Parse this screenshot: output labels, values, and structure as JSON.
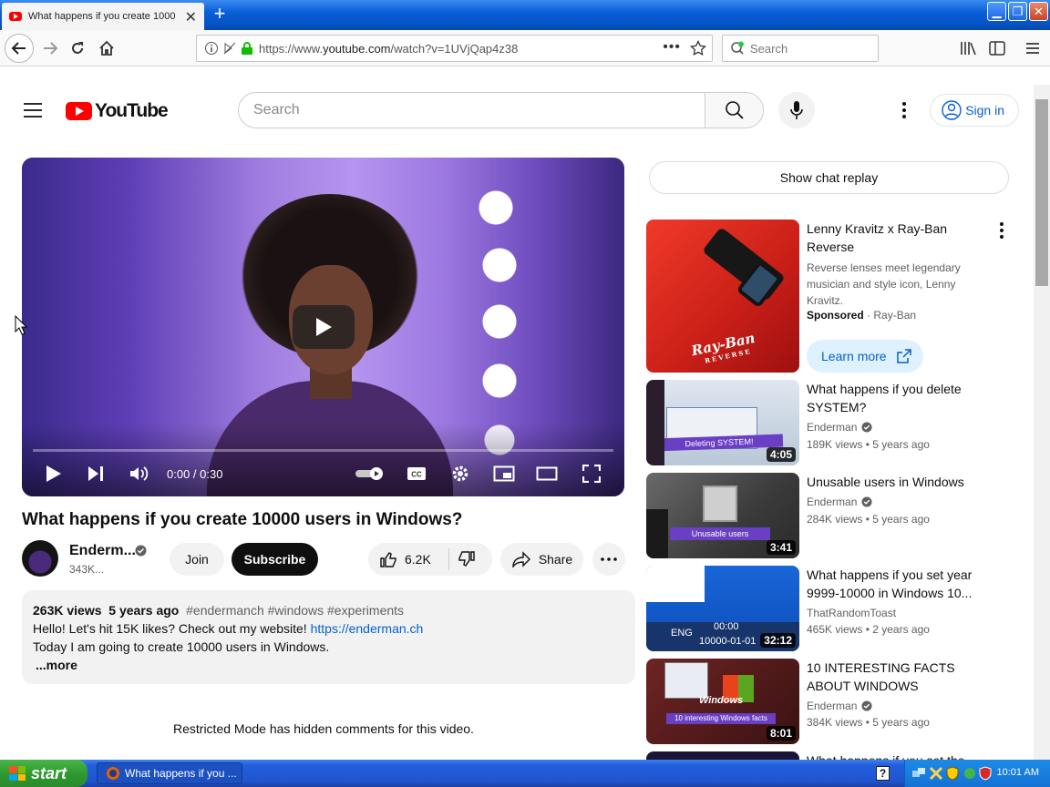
{
  "browser": {
    "tab_title": "What happens if you create 1000",
    "url": "https://www.youtube.com/watch?v=1UVjQap4z38",
    "url_prefix": "https://www.",
    "url_domain": "youtube.com",
    "url_path": "/watch?v=1UVjQap4z38",
    "search_placeholder": "Search"
  },
  "youtube": {
    "logo_text": "YouTube",
    "search_placeholder": "Search",
    "sign_in_label": "Sign in",
    "accent": "#ff0000",
    "link_color": "#065fd4"
  },
  "player": {
    "time": "0:00 / 0:30",
    "progress_fraction": 0.0
  },
  "video": {
    "title": "What happens if you create 10000 users in Windows?",
    "channel_name": "Enderm...",
    "subscribers": "343K...",
    "join_label": "Join",
    "subscribe_label": "Subscribe",
    "likes": "6.2K",
    "share_label": "Share"
  },
  "description": {
    "views": "263K views",
    "age": "5 years ago",
    "tags": "#endermanch #windows #experiments",
    "line1_text": "Hello! Let's hit 15K likes? Check out my website!",
    "line1_link": "https://enderman.ch",
    "line2": "Today I am going to create 10000 users in Windows.",
    "more_label": "...more"
  },
  "comments_note": "Restricted Mode has hidden comments for this video.",
  "sidebar": {
    "chat_replay_label": "Show chat replay",
    "ad": {
      "title": "Lenny Kravitz x Ray-Ban Reverse",
      "description": "Reverse lenses meet legendary musician and style icon, Lenny Kravitz.",
      "sponsored_label": "Sponsored",
      "sponsor_sep": "·",
      "advertiser": "Ray-Ban",
      "learn_more_label": "Learn more",
      "thumb_brand": "Ray-Ban",
      "thumb_sub": "REVERSE"
    },
    "recommendations": [
      {
        "title": "What happens if you delete SYSTEM?",
        "channel": "Enderman",
        "meta": "189K views • 5 years ago",
        "duration": "4:05",
        "thumb_caption": "Deleting SYSTEM!"
      },
      {
        "title": "Unusable users in Windows",
        "channel": "Enderman",
        "meta": "284K views • 5 years ago",
        "duration": "3:41",
        "thumb_caption": "Unusable users"
      },
      {
        "title": "What happens if you set year 9999-10000 in Windows 10...",
        "channel": "ThatRandomToast",
        "meta": "465K views • 2 years ago",
        "duration": "32:12",
        "thumb_time": "00:00",
        "thumb_date": "10000-01-01",
        "thumb_lang": "ENG"
      },
      {
        "title": "10 INTERESTING FACTS ABOUT WINDOWS",
        "channel": "Enderman",
        "meta": "384K views • 5 years ago",
        "duration": "8:01",
        "thumb_caption": "10 interesting Windows facts",
        "thumb_logo": "Windows"
      },
      {
        "title": "What happens if you set the"
      }
    ]
  },
  "taskbar": {
    "start_label": "start",
    "task_label": "What happens if you ...",
    "clock": "10:01 AM",
    "help_glyph": "?"
  }
}
